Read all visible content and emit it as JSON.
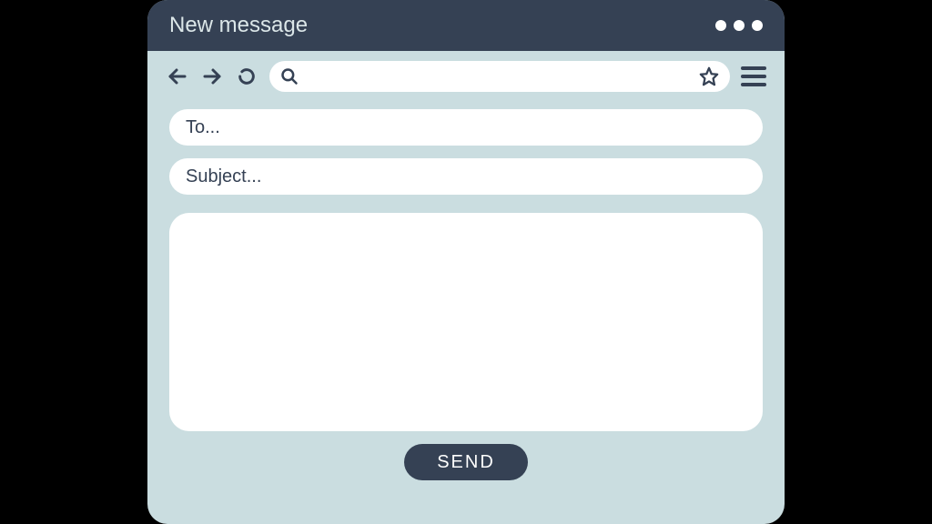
{
  "header": {
    "title": "New message"
  },
  "compose": {
    "to_placeholder": "To...",
    "subject_placeholder": "Subject...",
    "send_label": "SEND"
  }
}
